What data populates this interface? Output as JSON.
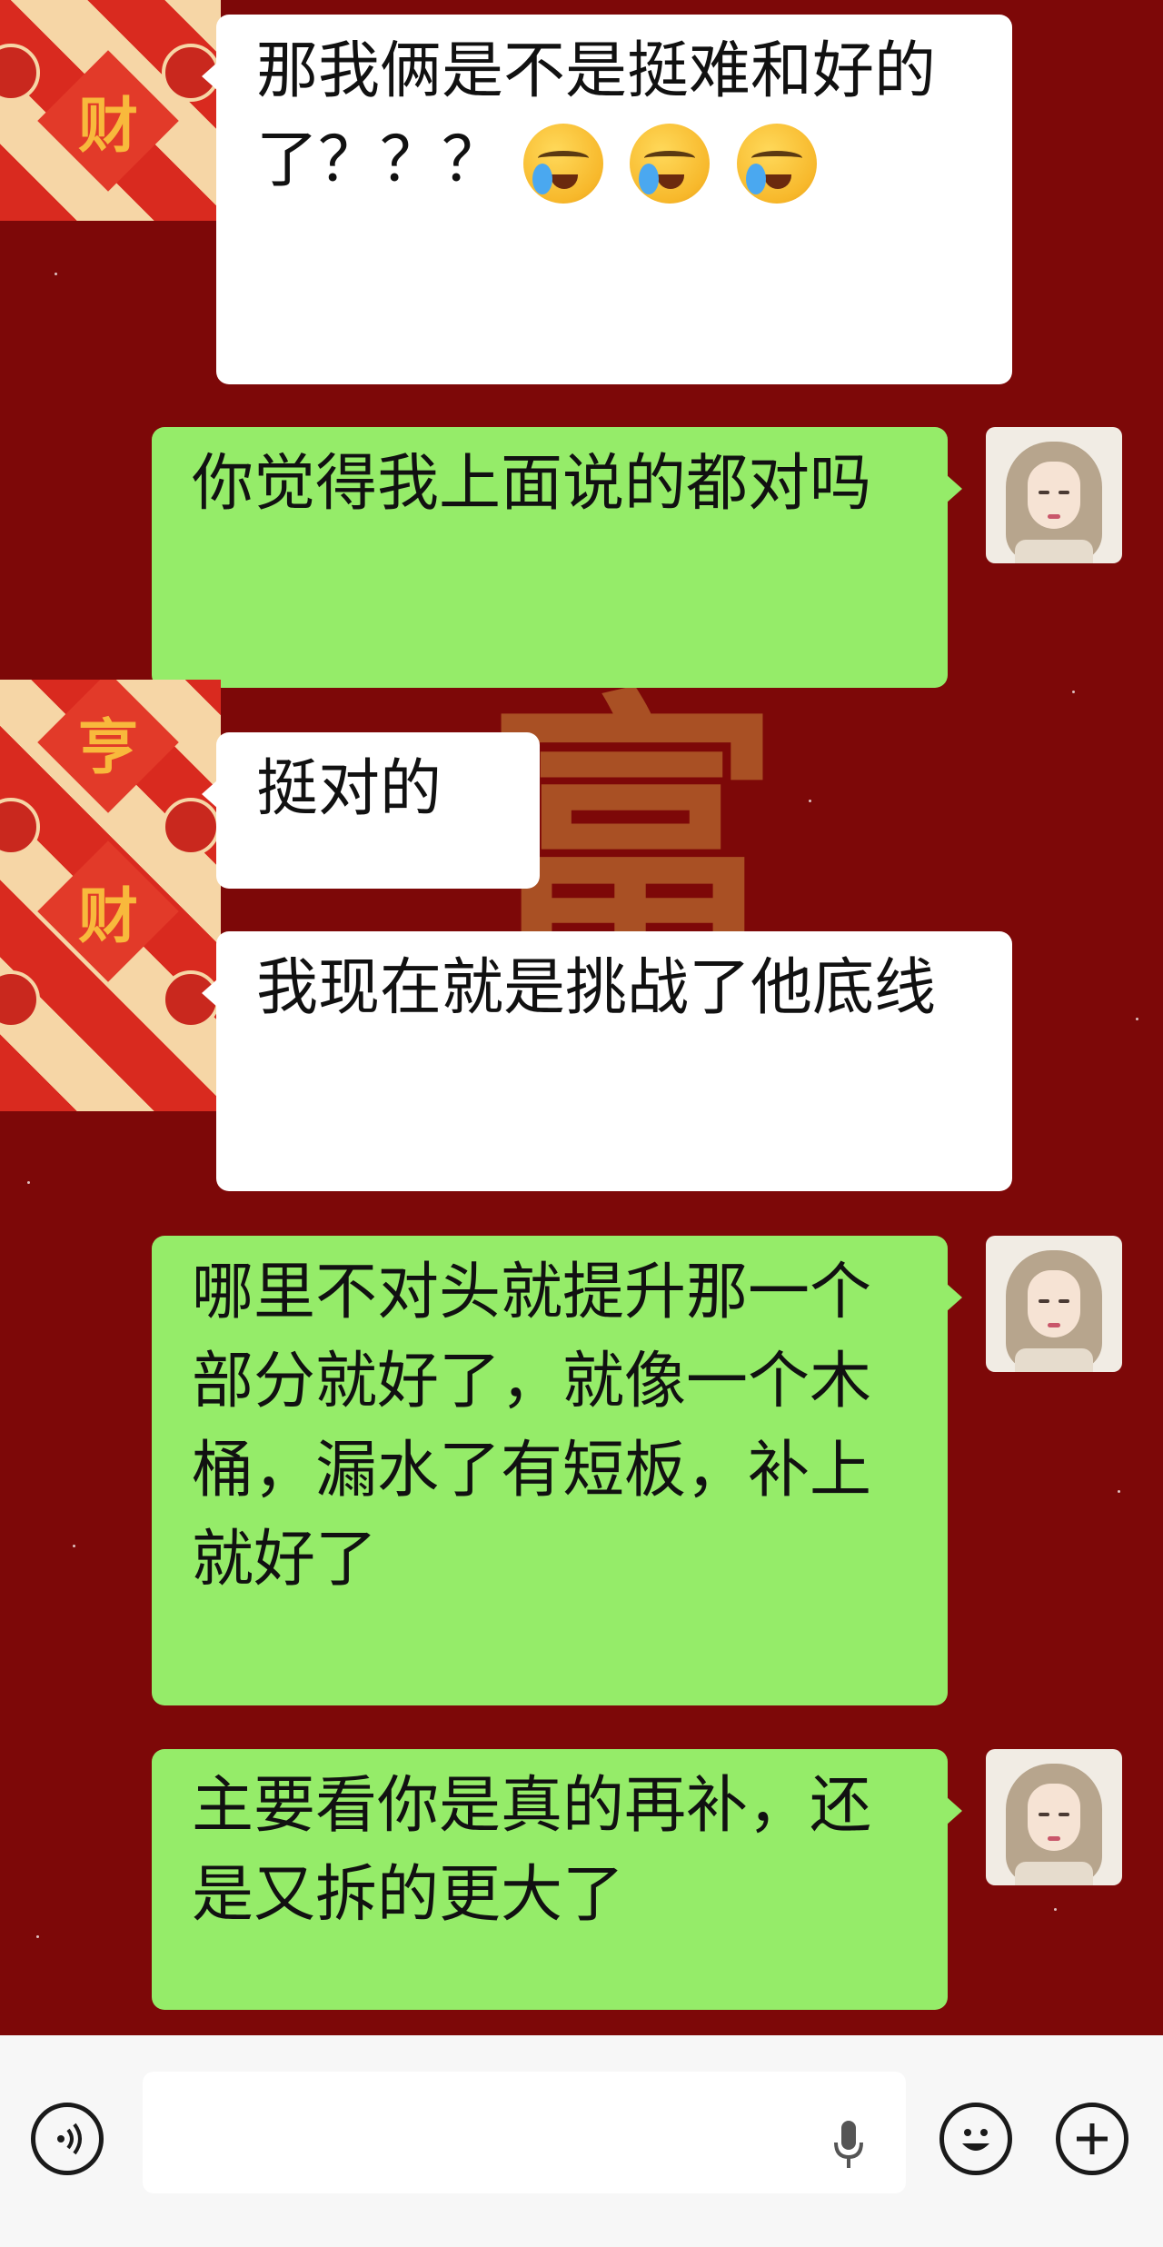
{
  "colors": {
    "chat_background": "#7d0808",
    "incoming_bubble": "#ffffff",
    "outgoing_bubble": "#95ec69",
    "input_bar": "#f7f7f7"
  },
  "background_glyph": "富",
  "left_avatar": {
    "tile_top_char": "财",
    "tile_mid_char": "亨",
    "tile_bottom_char": "财"
  },
  "messages": [
    {
      "side": "left",
      "text": "那我俩是不是挺难和好的了？？？",
      "emoji": [
        "face-with-tears-icon",
        "face-with-tears-icon",
        "face-with-tears-icon"
      ]
    },
    {
      "side": "right",
      "text": "你觉得我上面说的都对吗"
    },
    {
      "side": "left",
      "text": "挺对的"
    },
    {
      "side": "left",
      "text": "我现在就是挑战了他底线"
    },
    {
      "side": "right",
      "text": "哪里不对头就提升那一个部分就好了，就像一个木桶，漏水了有短板，补上就好了"
    },
    {
      "side": "right",
      "text": "主要看你是真的再补，还是又拆的更大了"
    }
  ],
  "input_bar": {
    "voice_icon": "voice-icon",
    "mic_icon": "microphone-icon",
    "emoji_icon": "emoji-smile-icon",
    "plus_icon": "plus-icon"
  }
}
